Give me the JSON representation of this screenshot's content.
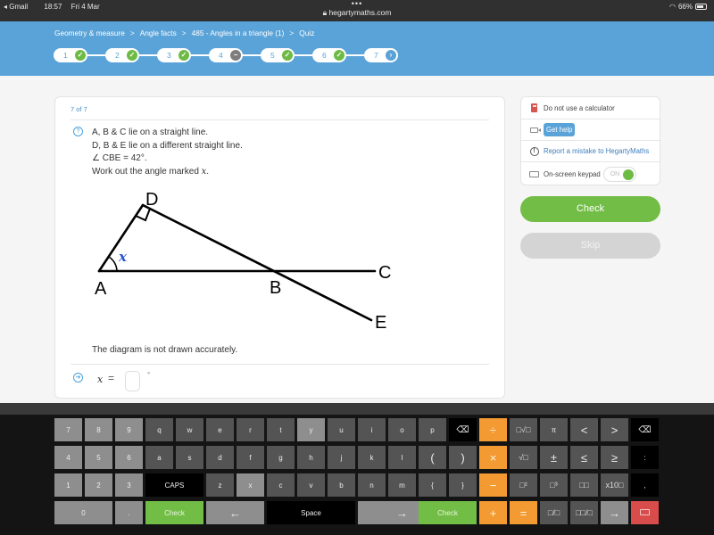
{
  "status_bar": {
    "back_app": "Gmail",
    "time": "18:57",
    "date": "Fri 4 Mar",
    "url": "hegartymaths.com",
    "battery": "66%"
  },
  "breadcrumb": [
    "Geometry & measure",
    "Angle facts",
    "485 - Angles in a triangle (1)",
    "Quiz"
  ],
  "progress": [
    {
      "num": "1",
      "status": "correct"
    },
    {
      "num": "2",
      "status": "correct"
    },
    {
      "num": "3",
      "status": "correct"
    },
    {
      "num": "4",
      "status": "skipped"
    },
    {
      "num": "5",
      "status": "correct"
    },
    {
      "num": "6",
      "status": "correct"
    },
    {
      "num": "7",
      "status": "current"
    }
  ],
  "question": {
    "counter": "7 of 7",
    "lines": [
      "A, B & C lie on a straight line.",
      "D, B & E lie on a different straight line.",
      "∠ CBE = 42°.",
      "Work out the angle marked "
    ],
    "variable": "x",
    "diagram_labels": {
      "A": "A",
      "B": "B",
      "C": "C",
      "D": "D",
      "E": "E",
      "angle": "x"
    },
    "note": "The diagram is not drawn accurately.",
    "answer_label": "x",
    "answer_eq": "=",
    "answer_value": "",
    "answer_unit": "°"
  },
  "side_panel": {
    "calculator": "Do not use a calculator",
    "get_help": "Get help",
    "report": "Report a mistake to HegartyMaths",
    "keypad_label": "On-screen keypad",
    "keypad_toggle": "ON"
  },
  "buttons": {
    "check": "Check",
    "skip": "Skip"
  },
  "keypad": {
    "row1": [
      "7",
      "8",
      "9",
      "q",
      "w",
      "e",
      "r",
      "t",
      "y",
      "u",
      "i",
      "o",
      "p",
      "⌫",
      "÷",
      "□√□",
      "π",
      "<",
      ">",
      "⌫"
    ],
    "row2": [
      "4",
      "5",
      "6",
      "a",
      "s",
      "d",
      "f",
      "g",
      "h",
      "j",
      "k",
      "l",
      "(",
      ")",
      "×",
      "√□",
      "±",
      "≤",
      "≥",
      ":"
    ],
    "row3": [
      "1",
      "2",
      "3",
      "CAPS",
      "z",
      "x",
      "c",
      "v",
      "b",
      "n",
      "m",
      "{",
      "}",
      "−",
      "□²",
      "□³",
      "□□",
      "x10□",
      ","
    ],
    "row4": [
      "0",
      ".",
      "Check",
      "←",
      "Space",
      "→",
      "Check",
      "+",
      "=",
      "□/□",
      "□□/□",
      "→",
      "hide-keyboard"
    ]
  },
  "colors": {
    "header_blue": "#5aa3d8",
    "success_green": "#72bd46",
    "skip_grey": "#d4d4d4",
    "operator_orange": "#f39a32",
    "hide_red": "#d84c4c"
  }
}
